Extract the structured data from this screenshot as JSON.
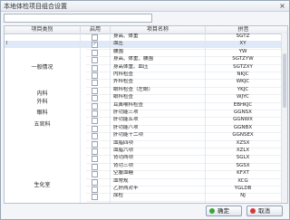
{
  "window": {
    "title": "本地体检项目组合设置",
    "close_glyph": "×"
  },
  "search": {
    "value": ""
  },
  "columns": {
    "category": "项目类别",
    "enabled": "启用",
    "name": "项目名称",
    "code": "拼音"
  },
  "row_marker": "I",
  "categories": [
    {
      "label": "一般情况",
      "row": 4.5
    },
    {
      "label": "内科",
      "row": 8
    },
    {
      "label": "外科",
      "row": 9
    },
    {
      "label": "眼科",
      "row": 10.5
    },
    {
      "label": "五官科",
      "row": 12
    },
    {
      "label": "生化室",
      "row": 20
    }
  ],
  "rows": [
    {
      "name": "身高、体重",
      "code": "SGTZ",
      "checked": false
    },
    {
      "name": "血压",
      "code": "XY",
      "checked": true
    },
    {
      "name": "腰围",
      "code": "YW",
      "checked": false
    },
    {
      "name": "身高、体重、腰围",
      "code": "SGTZYW",
      "checked": false
    },
    {
      "name": "身高体重、血压",
      "code": "SGTZXY",
      "checked": false
    },
    {
      "name": "内科检查",
      "code": "NKJC",
      "checked": false
    },
    {
      "name": "外科检查",
      "code": "WKJC",
      "checked": false
    },
    {
      "name": "眼科检查（左眼）",
      "code": "YKJC",
      "checked": false
    },
    {
      "name": "眼科检查",
      "code": "WJYC",
      "checked": false
    },
    {
      "name": "耳鼻喉科检查",
      "code": "EBHKJC",
      "checked": false
    },
    {
      "name": "肝功能三项",
      "code": "GGNSX",
      "checked": false
    },
    {
      "name": "肝功能五项",
      "code": "GGNWX",
      "checked": false
    },
    {
      "name": "肝功能八项",
      "code": "GGNBX",
      "checked": false
    },
    {
      "name": "肝功能十二项",
      "code": "GGNSEX",
      "checked": false
    },
    {
      "name": "血脂四项",
      "code": "XZSX",
      "checked": false
    },
    {
      "name": "血脂六项",
      "code": "XZLX",
      "checked": false
    },
    {
      "name": "肾功两项",
      "code": "SGLX",
      "checked": false
    },
    {
      "name": "肾功三项",
      "code": "SGSX",
      "checked": false
    },
    {
      "name": "空腹血糖",
      "code": "KFXT",
      "checked": false
    },
    {
      "name": "血常规",
      "code": "XCG",
      "checked": false
    },
    {
      "name": "乙肝两对半",
      "code": "YGLDB",
      "checked": false
    },
    {
      "name": "尿检",
      "code": "NJ",
      "checked": false
    }
  ],
  "buttons": {
    "ok": "确定",
    "cancel": "取消"
  },
  "colors": {
    "ok_icon": "#3aa53a",
    "cancel_icon": "#d23a3a",
    "selection": "#dfe9f7"
  }
}
